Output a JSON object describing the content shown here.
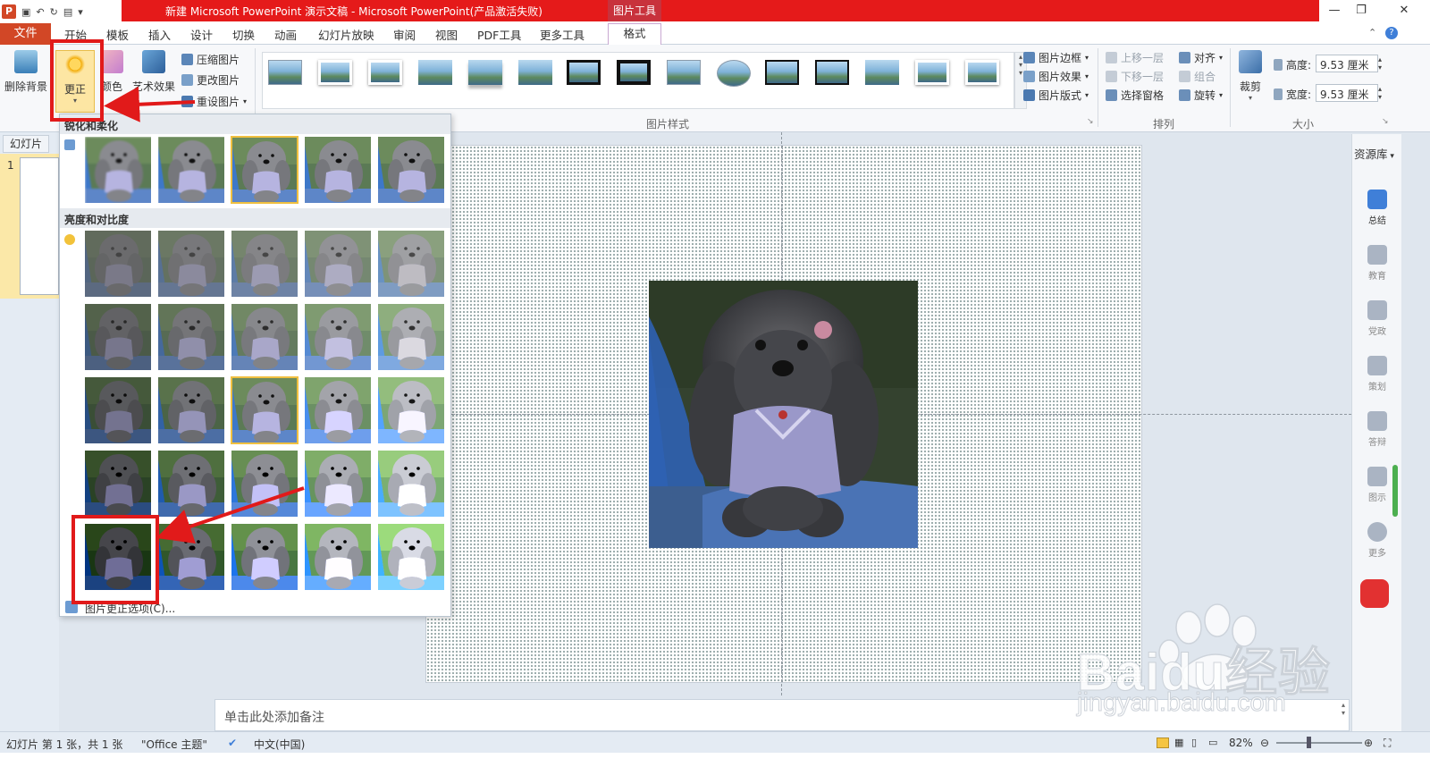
{
  "title_bar": {
    "window_title": "新建 Microsoft PowerPoint 演示文稿 - Microsoft PowerPoint(产品激活失败)",
    "context_tab_group": "图片工具",
    "min_glyph": "—",
    "restore_glyph": "❐",
    "close_glyph": "✕"
  },
  "menu": {
    "file": "文件",
    "tabs": [
      "开始",
      "模板",
      "插入",
      "设计",
      "切换",
      "动画",
      "幻灯片放映",
      "审阅",
      "视图",
      "PDF工具",
      "更多工具"
    ],
    "format_tab": "格式"
  },
  "ribbon": {
    "remove_background": "删除背景",
    "corrections": "更正",
    "color": "颜色",
    "artistic_effects": "艺术效果",
    "compress": "压缩图片",
    "change_picture": "更改图片",
    "reset_picture": "重设图片",
    "picture_border": "图片边框",
    "picture_effects": "图片效果",
    "picture_layout": "图片版式",
    "bring_forward": "上移一层",
    "send_backward": "下移一层",
    "selection_pane": "选择窗格",
    "align": "对齐",
    "group": "组合",
    "rotate": "旋转",
    "crop": "裁剪",
    "height_label": "高度:",
    "height_value": "9.53 厘米",
    "width_label": "宽度:",
    "width_value": "9.53 厘米",
    "group_picture_styles": "图片样式",
    "group_arrange": "排列",
    "group_size": "大小"
  },
  "left_panel": {
    "tab": "幻灯片",
    "slide_number": "1"
  },
  "dropdown": {
    "section_sharpen": "锐化和柔化",
    "section_brightness": "亮度和对比度",
    "footer": "图片更正选项(C)...",
    "sharpen_selected_index": 2,
    "brightness_selected": [
      2,
      2
    ],
    "brightness_levels": [
      -0.4,
      -0.2,
      0,
      0.2,
      0.4
    ],
    "contrast_levels": [
      -0.4,
      -0.2,
      0,
      0.2,
      0.4
    ]
  },
  "right_panel": {
    "title": "资源库",
    "items": [
      "总结",
      "教育",
      "党政",
      "策划",
      "答辩",
      "图示",
      "更多"
    ]
  },
  "notes": {
    "placeholder": "单击此处添加备注"
  },
  "status_bar": {
    "slide_info": "幻灯片 第 1 张，共 1 张",
    "theme": "\"Office 主题\"",
    "language": "中文(中国)",
    "zoom": "82%"
  },
  "watermark": {
    "brand": "Baidu经验",
    "url": "jingyan.baidu.com"
  },
  "colors": {
    "title_red": "#e51a1a",
    "file_tab": "#d24726",
    "annotation_red": "#e11a1a",
    "selected_border": "#f0c040"
  }
}
